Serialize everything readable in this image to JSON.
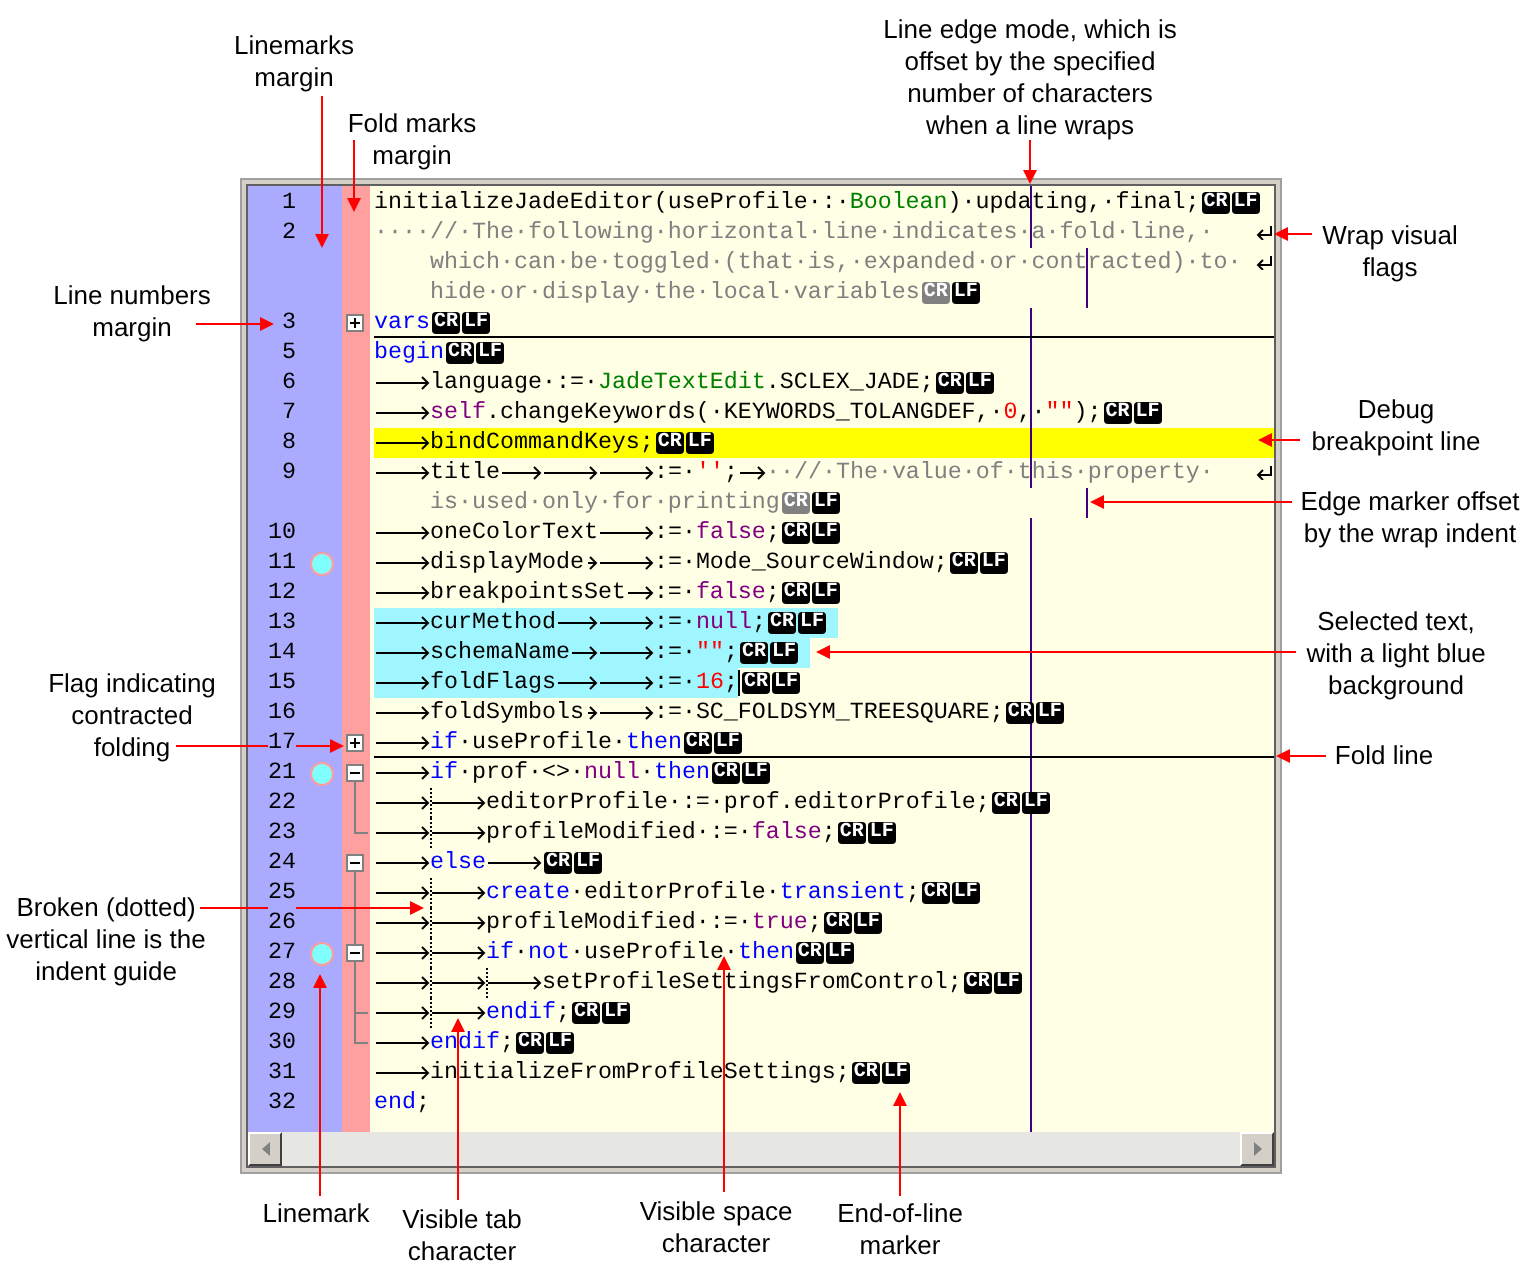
{
  "editor": {
    "lines": [
      {
        "number": "1",
        "mark": false,
        "breakpoint": false,
        "selected": false,
        "rows": [
          [
            {
              "kind": "plain",
              "text": "initializeJadeEditor(useProfile·:·"
            },
            {
              "kind": "class",
              "text": "Boolean"
            },
            {
              "kind": "plain",
              "text": ")·updating,·final;"
            }
          ]
        ],
        "eol": [
          {
            "text": "CR",
            "dimmed": false
          },
          {
            "text": "LF",
            "dimmed": false
          }
        ]
      },
      {
        "number": "2",
        "mark": false,
        "breakpoint": false,
        "selected": false,
        "rows": [
          [
            {
              "kind": "comment",
              "text": "····//·The·following·horizontal·line·indicates·a·fold·line,·"
            }
          ],
          [
            {
              "kind": "comment",
              "text": "which·can·be·toggled·(that·is,·expanded·or·contracted)·to·"
            }
          ],
          [
            {
              "kind": "comment",
              "text": "hide·or·display·the·local·variables"
            }
          ]
        ],
        "eol": [
          {
            "text": "CR",
            "dimmed": true
          },
          {
            "text": "LF",
            "dimmed": false
          }
        ]
      },
      {
        "number": "3",
        "mark": false,
        "breakpoint": false,
        "selected": false,
        "fold": {
          "kind": "plus"
        },
        "rows": [
          [
            {
              "kind": "keyword",
              "text": "vars"
            }
          ]
        ],
        "eol": [
          {
            "text": "CR",
            "dimmed": false
          },
          {
            "text": "LF",
            "dimmed": false
          }
        ]
      },
      {
        "number": "5",
        "mark": false,
        "breakpoint": false,
        "selected": false,
        "rows": [
          [
            {
              "kind": "keyword",
              "text": "begin"
            }
          ]
        ],
        "eol": [
          {
            "text": "CR",
            "dimmed": false
          },
          {
            "text": "LF",
            "dimmed": false
          }
        ]
      },
      {
        "number": "6",
        "mark": false,
        "breakpoint": false,
        "selected": false,
        "rows": [
          [
            {
              "kind": "tab"
            },
            {
              "kind": "plain",
              "text": "language·:=·"
            },
            {
              "kind": "class",
              "text": "JadeTextEdit"
            },
            {
              "kind": "plain",
              "text": ".SCLEX_JADE;"
            }
          ]
        ],
        "eol": [
          {
            "text": "CR",
            "dimmed": false
          },
          {
            "text": "LF",
            "dimmed": false
          }
        ]
      },
      {
        "number": "7",
        "mark": false,
        "breakpoint": false,
        "selected": false,
        "rows": [
          [
            {
              "kind": "tab"
            },
            {
              "kind": "literal",
              "text": "self"
            },
            {
              "kind": "plain",
              "text": ".changeKeywords(·KEYWORDS_TOLANGDEF,·"
            },
            {
              "kind": "number",
              "text": "0"
            },
            {
              "kind": "plain",
              "text": ",·"
            },
            {
              "kind": "string",
              "text": "\"\""
            },
            {
              "kind": "plain",
              "text": ");"
            }
          ]
        ],
        "eol": [
          {
            "text": "CR",
            "dimmed": false
          },
          {
            "text": "LF",
            "dimmed": false
          }
        ]
      },
      {
        "number": "8",
        "mark": false,
        "breakpoint": true,
        "selected": false,
        "rows": [
          [
            {
              "kind": "tab"
            },
            {
              "kind": "plain",
              "text": "bindCommandKeys;"
            }
          ]
        ],
        "eol": [
          {
            "text": "CR",
            "dimmed": false
          },
          {
            "text": "LF",
            "dimmed": false
          }
        ]
      },
      {
        "number": "9",
        "mark": false,
        "breakpoint": false,
        "selected": false,
        "rows": [
          [
            {
              "kind": "tab"
            },
            {
              "kind": "plain",
              "text": "title"
            },
            {
              "kind": "tab"
            },
            {
              "kind": "tab"
            },
            {
              "kind": "tab"
            },
            {
              "kind": "plain",
              "text": ":=·"
            },
            {
              "kind": "string",
              "text": "''"
            },
            {
              "kind": "plain",
              "text": ";"
            },
            {
              "kind": "tab"
            },
            {
              "kind": "comment",
              "text": "··//·The·value·of·this·property·"
            }
          ],
          [
            {
              "kind": "comment",
              "text": "is·used·only·for·printing"
            }
          ]
        ],
        "eol": [
          {
            "text": "CR",
            "dimmed": true
          },
          {
            "text": "LF",
            "dimmed": false
          }
        ]
      },
      {
        "number": "10",
        "mark": false,
        "breakpoint": false,
        "selected": false,
        "rows": [
          [
            {
              "kind": "tab"
            },
            {
              "kind": "plain",
              "text": "oneColorText"
            },
            {
              "kind": "tab"
            },
            {
              "kind": "plain",
              "text": ":=·"
            },
            {
              "kind": "literal",
              "text": "false"
            },
            {
              "kind": "plain",
              "text": ";"
            }
          ]
        ],
        "eol": [
          {
            "text": "CR",
            "dimmed": false
          },
          {
            "text": "LF",
            "dimmed": false
          }
        ]
      },
      {
        "number": "11",
        "mark": true,
        "breakpoint": false,
        "selected": false,
        "rows": [
          [
            {
              "kind": "tab"
            },
            {
              "kind": "plain",
              "text": "displayMode"
            },
            {
              "kind": "tab"
            },
            {
              "kind": "tab"
            },
            {
              "kind": "plain",
              "text": ":=·Mode_SourceWindow;"
            }
          ]
        ],
        "eol": [
          {
            "text": "CR",
            "dimmed": false
          },
          {
            "text": "LF",
            "dimmed": false
          }
        ]
      },
      {
        "number": "12",
        "mark": false,
        "breakpoint": false,
        "selected": false,
        "rows": [
          [
            {
              "kind": "tab"
            },
            {
              "kind": "plain",
              "text": "breakpointsSet"
            },
            {
              "kind": "tab"
            },
            {
              "kind": "plain",
              "text": ":=·"
            },
            {
              "kind": "literal",
              "text": "false"
            },
            {
              "kind": "plain",
              "text": ";"
            }
          ]
        ],
        "eol": [
          {
            "text": "CR",
            "dimmed": false
          },
          {
            "text": "LF",
            "dimmed": false
          }
        ]
      },
      {
        "number": "13",
        "mark": false,
        "breakpoint": false,
        "selected": true,
        "rows": [
          [
            {
              "kind": "tab"
            },
            {
              "kind": "plain",
              "text": "curMethod"
            },
            {
              "kind": "tab"
            },
            {
              "kind": "tab"
            },
            {
              "kind": "plain",
              "text": ":=·"
            },
            {
              "kind": "literal",
              "text": "null"
            },
            {
              "kind": "plain",
              "text": ";"
            }
          ]
        ],
        "eol": [
          {
            "text": "CR",
            "dimmed": false
          },
          {
            "text": "LF",
            "dimmed": false
          }
        ]
      },
      {
        "number": "14",
        "mark": false,
        "breakpoint": false,
        "selected": true,
        "rows": [
          [
            {
              "kind": "tab"
            },
            {
              "kind": "plain",
              "text": "schemaName"
            },
            {
              "kind": "tab"
            },
            {
              "kind": "tab"
            },
            {
              "kind": "plain",
              "text": ":=·"
            },
            {
              "kind": "string",
              "text": "\"\""
            },
            {
              "kind": "plain",
              "text": ";"
            }
          ]
        ],
        "eol": [
          {
            "text": "CR",
            "dimmed": false
          },
          {
            "text": "LF",
            "dimmed": false
          }
        ]
      },
      {
        "number": "15",
        "mark": false,
        "breakpoint": false,
        "selected": true,
        "rows": [
          [
            {
              "kind": "tab"
            },
            {
              "kind": "plain",
              "text": "foldFlags"
            },
            {
              "kind": "tab"
            },
            {
              "kind": "tab"
            },
            {
              "kind": "plain",
              "text": ":=·"
            },
            {
              "kind": "number",
              "text": "16"
            },
            {
              "kind": "plain",
              "text": ";"
            },
            {
              "kind": "caret"
            }
          ]
        ],
        "eol": [
          {
            "text": "CR",
            "dimmed": false
          },
          {
            "text": "LF",
            "dimmed": false
          }
        ]
      },
      {
        "number": "16",
        "mark": false,
        "breakpoint": false,
        "selected": false,
        "rows": [
          [
            {
              "kind": "tab"
            },
            {
              "kind": "plain",
              "text": "foldSymbols"
            },
            {
              "kind": "tab"
            },
            {
              "kind": "tab"
            },
            {
              "kind": "plain",
              "text": ":=·SC_FOLDSYM_TREESQUARE;"
            }
          ]
        ],
        "eol": [
          {
            "text": "CR",
            "dimmed": false
          },
          {
            "text": "LF",
            "dimmed": false
          }
        ]
      },
      {
        "number": "17",
        "mark": false,
        "breakpoint": false,
        "selected": false,
        "fold": {
          "kind": "plus"
        },
        "rows": [
          [
            {
              "kind": "tab"
            },
            {
              "kind": "keyword",
              "text": "if"
            },
            {
              "kind": "plain",
              "text": "·useProfile·"
            },
            {
              "kind": "keyword",
              "text": "then"
            }
          ]
        ],
        "eol": [
          {
            "text": "CR",
            "dimmed": false
          },
          {
            "text": "LF",
            "dimmed": false
          }
        ]
      },
      {
        "number": "21",
        "mark": true,
        "breakpoint": false,
        "selected": false,
        "fold": {
          "kind": "minus"
        },
        "rows": [
          [
            {
              "kind": "tab"
            },
            {
              "kind": "keyword",
              "text": "if"
            },
            {
              "kind": "plain",
              "text": "·prof·<>·"
            },
            {
              "kind": "literal",
              "text": "null"
            },
            {
              "kind": "plain",
              "text": "·"
            },
            {
              "kind": "keyword",
              "text": "then"
            }
          ]
        ],
        "eol": [
          {
            "text": "CR",
            "dimmed": false
          },
          {
            "text": "LF",
            "dimmed": false
          }
        ]
      },
      {
        "number": "22",
        "mark": false,
        "breakpoint": false,
        "selected": false,
        "fold": {
          "kind": "line"
        },
        "rows": [
          [
            {
              "kind": "tab"
            },
            {
              "kind": "tab"
            },
            {
              "kind": "plain",
              "text": "editorProfile·:=·prof.editorProfile;"
            }
          ]
        ],
        "eol": [
          {
            "text": "CR",
            "dimmed": false
          },
          {
            "text": "LF",
            "dimmed": false
          }
        ]
      },
      {
        "number": "23",
        "mark": false,
        "breakpoint": false,
        "selected": false,
        "fold": {
          "kind": "end"
        },
        "rows": [
          [
            {
              "kind": "tab"
            },
            {
              "kind": "tab"
            },
            {
              "kind": "plain",
              "text": "profileModified·:=·"
            },
            {
              "kind": "literal",
              "text": "false"
            },
            {
              "kind": "plain",
              "text": ";"
            }
          ]
        ],
        "eol": [
          {
            "text": "CR",
            "dimmed": false
          },
          {
            "text": "LF",
            "dimmed": false
          }
        ]
      },
      {
        "number": "24",
        "mark": false,
        "breakpoint": false,
        "selected": false,
        "fold": {
          "kind": "minus"
        },
        "rows": [
          [
            {
              "kind": "tab"
            },
            {
              "kind": "keyword",
              "text": "else"
            },
            {
              "kind": "tab"
            }
          ]
        ],
        "eol": [
          {
            "text": "CR",
            "dimmed": false
          },
          {
            "text": "LF",
            "dimmed": false
          }
        ]
      },
      {
        "number": "25",
        "mark": false,
        "breakpoint": false,
        "selected": false,
        "fold": {
          "kind": "line"
        },
        "rows": [
          [
            {
              "kind": "tab"
            },
            {
              "kind": "tab"
            },
            {
              "kind": "keyword",
              "text": "create"
            },
            {
              "kind": "plain",
              "text": "·editorProfile·"
            },
            {
              "kind": "keyword",
              "text": "transient"
            },
            {
              "kind": "plain",
              "text": ";"
            }
          ]
        ],
        "eol": [
          {
            "text": "CR",
            "dimmed": false
          },
          {
            "text": "LF",
            "dimmed": false
          }
        ]
      },
      {
        "number": "26",
        "mark": false,
        "breakpoint": false,
        "selected": false,
        "fold": {
          "kind": "line"
        },
        "rows": [
          [
            {
              "kind": "tab"
            },
            {
              "kind": "tab"
            },
            {
              "kind": "plain",
              "text": "profileModified·:=·"
            },
            {
              "kind": "literal",
              "text": "true"
            },
            {
              "kind": "plain",
              "text": ";"
            }
          ]
        ],
        "eol": [
          {
            "text": "CR",
            "dimmed": false
          },
          {
            "text": "LF",
            "dimmed": false
          }
        ]
      },
      {
        "number": "27",
        "mark": true,
        "breakpoint": false,
        "selected": false,
        "fold": {
          "kind": "nested_minus"
        },
        "rows": [
          [
            {
              "kind": "tab"
            },
            {
              "kind": "tab"
            },
            {
              "kind": "keyword",
              "text": "if"
            },
            {
              "kind": "plain",
              "text": "·"
            },
            {
              "kind": "keyword",
              "text": "not"
            },
            {
              "kind": "plain",
              "text": "·useProfile·"
            },
            {
              "kind": "keyword",
              "text": "then"
            }
          ]
        ],
        "eol": [
          {
            "text": "CR",
            "dimmed": false
          },
          {
            "text": "LF",
            "dimmed": false
          }
        ]
      },
      {
        "number": "28",
        "mark": false,
        "breakpoint": false,
        "selected": false,
        "fold": {
          "kind": "line"
        },
        "rows": [
          [
            {
              "kind": "tab"
            },
            {
              "kind": "tab"
            },
            {
              "kind": "tab"
            },
            {
              "kind": "plain",
              "text": "setProfileSettingsFromControl;"
            }
          ]
        ],
        "eol": [
          {
            "text": "CR",
            "dimmed": false
          },
          {
            "text": "LF",
            "dimmed": false
          }
        ]
      },
      {
        "number": "29",
        "mark": false,
        "breakpoint": false,
        "selected": false,
        "fold": {
          "kind": "tee"
        },
        "rows": [
          [
            {
              "kind": "tab"
            },
            {
              "kind": "tab"
            },
            {
              "kind": "keyword",
              "text": "endif"
            },
            {
              "kind": "plain",
              "text": ";"
            }
          ]
        ],
        "eol": [
          {
            "text": "CR",
            "dimmed": false
          },
          {
            "text": "LF",
            "dimmed": false
          }
        ]
      },
      {
        "number": "30",
        "mark": false,
        "breakpoint": false,
        "selected": false,
        "fold": {
          "kind": "end"
        },
        "rows": [
          [
            {
              "kind": "tab"
            },
            {
              "kind": "keyword",
              "text": "endif"
            },
            {
              "kind": "plain",
              "text": ";"
            }
          ]
        ],
        "eol": [
          {
            "text": "CR",
            "dimmed": false
          },
          {
            "text": "LF",
            "dimmed": false
          }
        ]
      },
      {
        "number": "31",
        "mark": false,
        "breakpoint": false,
        "selected": false,
        "rows": [
          [
            {
              "kind": "tab"
            },
            {
              "kind": "plain",
              "text": "initializeFromProfileSettings;"
            }
          ]
        ],
        "eol": [
          {
            "text": "CR",
            "dimmed": false
          },
          {
            "text": "LF",
            "dimmed": false
          }
        ]
      },
      {
        "number": "32",
        "mark": false,
        "breakpoint": false,
        "selected": false,
        "rows": [
          [
            {
              "kind": "keyword",
              "text": "end"
            },
            {
              "kind": "plain",
              "text": ";"
            }
          ]
        ]
      }
    ]
  },
  "callouts": [
    {
      "lines": [
        "Linemarks",
        "margin"
      ]
    },
    {
      "lines": [
        "Fold marks",
        "margin"
      ]
    },
    {
      "lines": [
        "Line edge mode, which is",
        "offset by the specified",
        "number of characters",
        "when a line wraps"
      ]
    },
    {
      "lines": [
        "Line numbers",
        "margin"
      ]
    },
    {
      "lines": [
        "Wrap visual",
        "flags"
      ]
    },
    {
      "lines": [
        "Debug",
        "breakpoint line"
      ]
    },
    {
      "lines": [
        "Edge marker offset",
        "by the wrap indent"
      ]
    },
    {
      "lines": [
        "Selected text,",
        "with a light blue",
        "background"
      ]
    },
    {
      "lines": [
        "Flag indicating",
        "contracted",
        "folding"
      ]
    },
    {
      "lines": [
        "Fold line"
      ]
    },
    {
      "lines": [
        "Broken (dotted)",
        "vertical line is the",
        "indent guide"
      ]
    },
    {
      "lines": [
        "Linemark"
      ]
    },
    {
      "lines": [
        "Visible tab",
        "character"
      ]
    },
    {
      "lines": [
        "Visible space",
        "character"
      ]
    },
    {
      "lines": [
        "End-of-line",
        "marker"
      ]
    }
  ]
}
